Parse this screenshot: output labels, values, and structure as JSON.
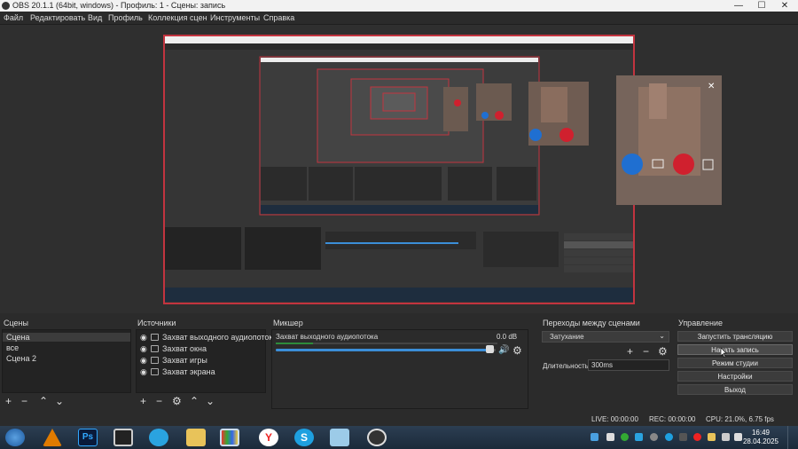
{
  "window": {
    "title": "OBS 20.1.1 (64bit, windows) - Профиль: 1 - Сцены: запись",
    "minimize": "—",
    "maximize": "☐",
    "close": "✕"
  },
  "menu": [
    "Файл",
    "Редактировать",
    "Вид",
    "Профиль",
    "Коллекция сцен",
    "Инструменты",
    "Справка"
  ],
  "scenes": {
    "title": "Сцены",
    "items": [
      "Сцена",
      "все",
      "Сцена 2"
    ]
  },
  "sources": {
    "title": "Источники",
    "items": [
      "Захват выходного аудиопотока",
      "Захват окна",
      "Захват игры",
      "Захват экрана"
    ]
  },
  "mixer": {
    "title": "Микшер",
    "track": "Захват выходного аудиопотока",
    "level": "0.0 dB",
    "volume": 0.97
  },
  "transitions": {
    "title": "Переходы между сценами",
    "selected": "Затухание",
    "duration_label": "Длительность",
    "duration": "300ms"
  },
  "controls": {
    "title": "Управление",
    "buttons": [
      "Запустить трансляцию",
      "Начать запись",
      "Режим студии",
      "Настройки",
      "Выход"
    ]
  },
  "status": {
    "live": "LIVE: 00:00:00",
    "rec": "REC: 00:00:00",
    "cpu": "CPU: 21.0%, 6.75 fps"
  },
  "taskbar": {
    "time": "16:49",
    "date": "28.04.2025",
    "ps_label": "Ps"
  },
  "colors": {
    "accent_red": "#c2343f",
    "call_blue": "#1f6fd1",
    "call_red": "#d0202e",
    "meter_green": "#2e8b3a",
    "slider_blue": "#3b8ed8"
  }
}
